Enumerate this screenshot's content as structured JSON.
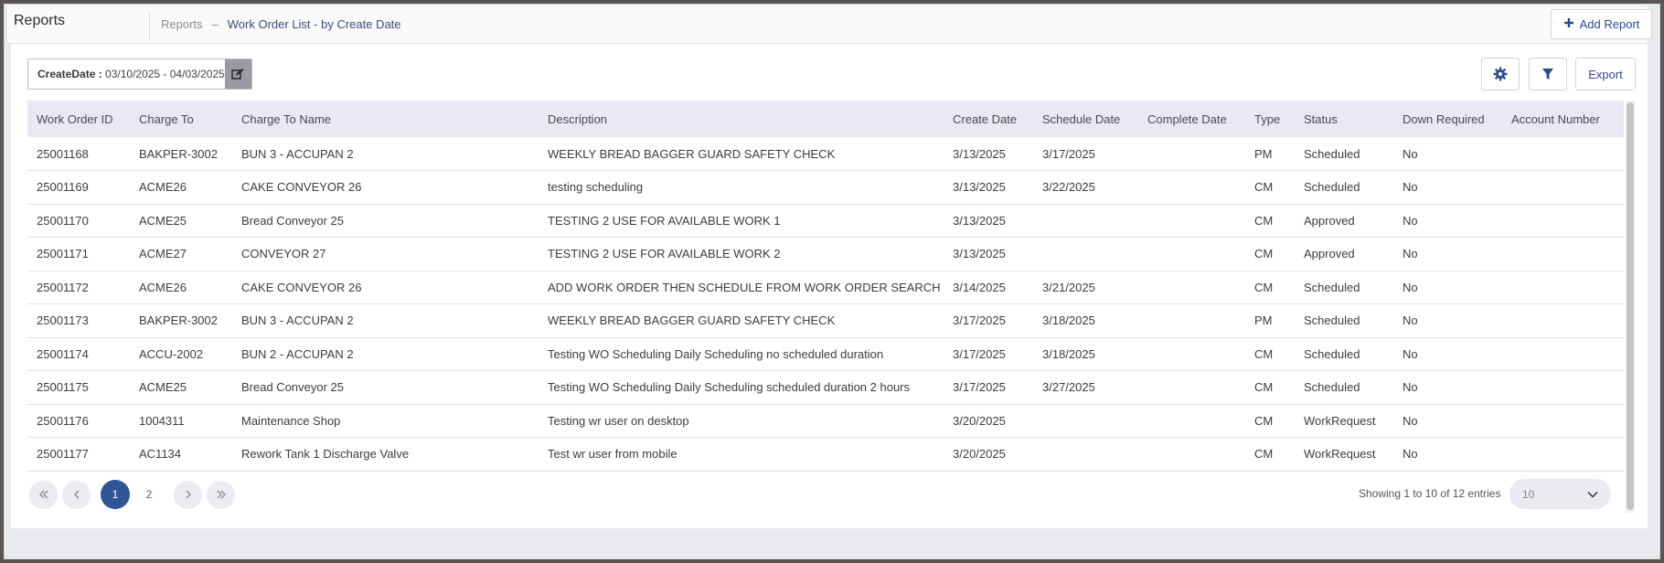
{
  "header": {
    "app_title": "Reports",
    "breadcrumb_root": "Reports",
    "breadcrumb_separator": "–",
    "breadcrumb_current": "Work Order List - by Create Date",
    "add_report_label": "Add Report"
  },
  "filter": {
    "key": "CreateDate :",
    "value": " 03/10/2025 - 04/03/2025"
  },
  "toolbar": {
    "export_label": "Export"
  },
  "table": {
    "columns": [
      "Work Order ID",
      "Charge To",
      "Charge To Name",
      "Description",
      "Create Date",
      "Schedule Date",
      "Complete Date",
      "Type",
      "Status",
      "Down Required",
      "Account Number"
    ],
    "rows": [
      [
        "25001168",
        "BAKPER-3002",
        "BUN 3 - ACCUPAN 2",
        "WEEKLY BREAD BAGGER GUARD SAFETY CHECK",
        "3/13/2025",
        "3/17/2025",
        "",
        "PM",
        "Scheduled",
        "No",
        ""
      ],
      [
        "25001169",
        "ACME26",
        "CAKE CONVEYOR 26",
        "testing scheduling",
        "3/13/2025",
        "3/22/2025",
        "",
        "CM",
        "Scheduled",
        "No",
        ""
      ],
      [
        "25001170",
        "ACME25",
        "Bread Conveyor 25",
        "TESTING 2 USE FOR AVAILABLE WORK 1",
        "3/13/2025",
        "",
        "",
        "CM",
        "Approved",
        "No",
        ""
      ],
      [
        "25001171",
        "ACME27",
        "CONVEYOR 27",
        "TESTING 2 USE FOR AVAILABLE WORK 2",
        "3/13/2025",
        "",
        "",
        "CM",
        "Approved",
        "No",
        ""
      ],
      [
        "25001172",
        "ACME26",
        "CAKE CONVEYOR 26",
        "ADD WORK ORDER THEN SCHEDULE FROM WORK ORDER SEARCH GRID",
        "3/14/2025",
        "3/21/2025",
        "",
        "CM",
        "Scheduled",
        "No",
        ""
      ],
      [
        "25001173",
        "BAKPER-3002",
        "BUN 3 - ACCUPAN 2",
        "WEEKLY BREAD BAGGER GUARD SAFETY CHECK",
        "3/17/2025",
        "3/18/2025",
        "",
        "PM",
        "Scheduled",
        "No",
        ""
      ],
      [
        "25001174",
        "ACCU-2002",
        "BUN 2 - ACCUPAN 2",
        "Testing WO Scheduling Daily Scheduling no scheduled duration",
        "3/17/2025",
        "3/18/2025",
        "",
        "CM",
        "Scheduled",
        "No",
        ""
      ],
      [
        "25001175",
        "ACME25",
        "Bread Conveyor 25",
        "Testing WO Scheduling Daily Scheduling scheduled duration 2 hours",
        "3/17/2025",
        "3/27/2025",
        "",
        "CM",
        "Scheduled",
        "No",
        ""
      ],
      [
        "25001176",
        "1004311",
        "Maintenance Shop",
        "Testing wr user on desktop",
        "3/20/2025",
        "",
        "",
        "CM",
        "WorkRequest",
        "No",
        ""
      ],
      [
        "25001177",
        "AC1134",
        "Rework Tank 1 Discharge Valve",
        "Test wr user from mobile",
        "3/20/2025",
        "",
        "",
        "CM",
        "WorkRequest",
        "No",
        ""
      ]
    ]
  },
  "pager": {
    "pages": [
      "1",
      "2"
    ],
    "active_page": "1",
    "entries_info": "Showing 1 to 10 of 12 entries",
    "page_size": "10"
  },
  "icons": {
    "add": "plus-icon",
    "edit": "edit-icon",
    "settings": "gear-icon",
    "filter": "funnel-icon",
    "first": "double-chevron-left-icon",
    "prev": "chevron-left-icon",
    "next": "chevron-right-icon",
    "last": "double-chevron-right-icon",
    "dropdown": "chevron-down-icon"
  },
  "colors": {
    "accent": "#2f5597",
    "header_row": "#e9e8f3"
  }
}
